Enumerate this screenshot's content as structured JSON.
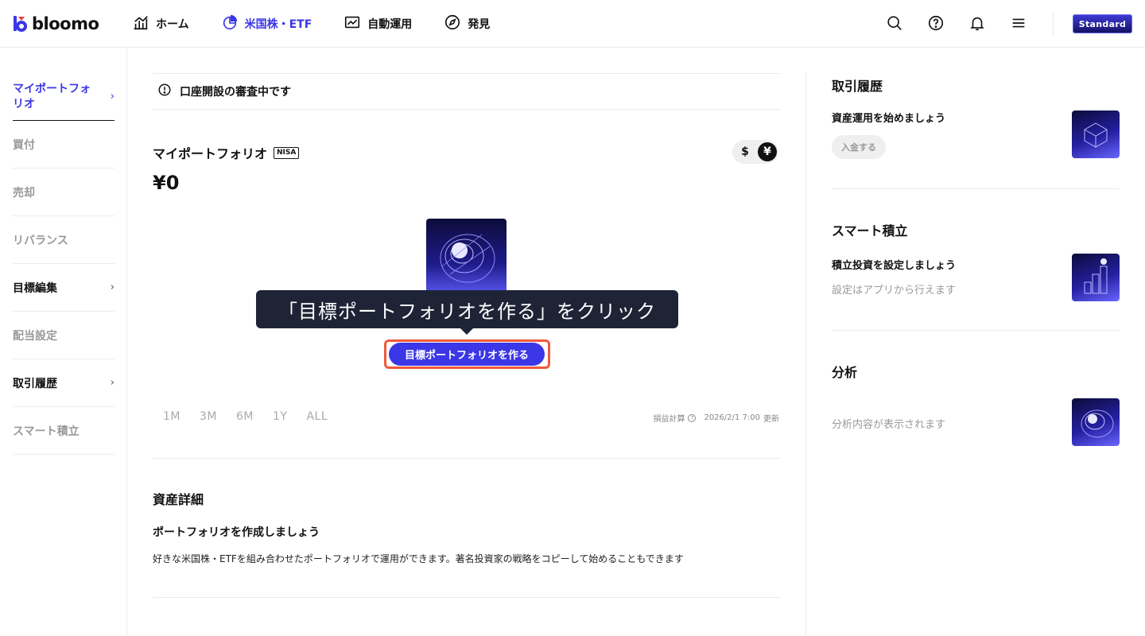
{
  "header": {
    "logo_text": "bloomo",
    "nav": [
      {
        "label": "ホーム",
        "icon": "chart-growth-icon",
        "active": false
      },
      {
        "label": "米国株・ETF",
        "icon": "pie-chart-icon",
        "active": true
      },
      {
        "label": "自動運用",
        "icon": "line-chart-icon",
        "active": false
      },
      {
        "label": "発見",
        "icon": "compass-icon",
        "active": false
      }
    ],
    "icons": [
      "search-icon",
      "help-icon",
      "bell-icon",
      "menu-icon"
    ],
    "plan_badge": "Standard"
  },
  "sidebar": {
    "items": [
      {
        "label": "マイポートフォリオ",
        "has_chevron": true,
        "state": "active"
      },
      {
        "label": "買付",
        "has_chevron": false,
        "state": "disabled"
      },
      {
        "label": "売却",
        "has_chevron": false,
        "state": "disabled"
      },
      {
        "label": "リバランス",
        "has_chevron": false,
        "state": "disabled"
      },
      {
        "label": "目標編集",
        "has_chevron": true,
        "state": "enabled"
      },
      {
        "label": "配当設定",
        "has_chevron": false,
        "state": "disabled"
      },
      {
        "label": "取引履歴",
        "has_chevron": true,
        "state": "enabled"
      },
      {
        "label": "スマート積立",
        "has_chevron": false,
        "state": "disabled"
      }
    ]
  },
  "main": {
    "notice": "口座開設の審査中です",
    "portfolio_title": "マイポートフォリオ",
    "nisa_badge": "NISA",
    "currency": {
      "usd": "$",
      "jpy": "¥",
      "selected": "jpy"
    },
    "amount": "¥0",
    "tooltip": "「目標ポートフォリオを作る」をクリック",
    "cta_label": "目標ポートフォリオを作る",
    "ranges": [
      "1M",
      "3M",
      "6M",
      "1Y",
      "ALL"
    ],
    "pnl_label": "損益計算",
    "updated_at": "2026/2/1 7:00",
    "updated_suffix": "更新",
    "asset_section": {
      "title": "資産詳細",
      "subtitle": "ポートフォリオを作成しましょう",
      "description": "好きな米国株・ETFを組み合わせたポートフォリオで運用ができます。著名投資家の戦略をコピーして始めることもできます"
    }
  },
  "right_panel": {
    "history": {
      "title": "取引履歴",
      "subtitle": "資産運用を始めましょう",
      "button": "入金する"
    },
    "smart": {
      "title": "スマート積立",
      "subtitle": "積立投資を設定しましょう",
      "note": "設定はアプリから行えます"
    },
    "analysis": {
      "title": "分析",
      "note": "分析内容が表示されます"
    }
  },
  "colors": {
    "accent": "#3b37e6",
    "highlight": "#ef5a3c",
    "tooltip_bg": "#1e2436"
  }
}
